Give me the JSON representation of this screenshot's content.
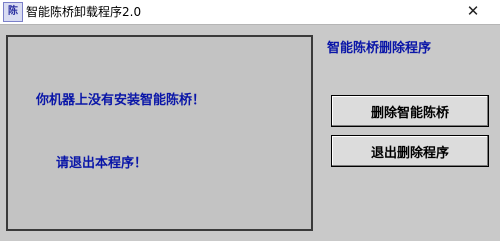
{
  "window": {
    "icon_text": "陈",
    "title": "智能陈桥卸载程序2.0",
    "close_glyph": "✕"
  },
  "main": {
    "message_not_installed": "你机器上没有安装智能陈桥！",
    "message_exit": "请退出本程序！",
    "right_title": "智能陈桥删除程序"
  },
  "buttons": {
    "delete_label": "删除智能陈桥",
    "exit_label": "退出删除程序"
  }
}
